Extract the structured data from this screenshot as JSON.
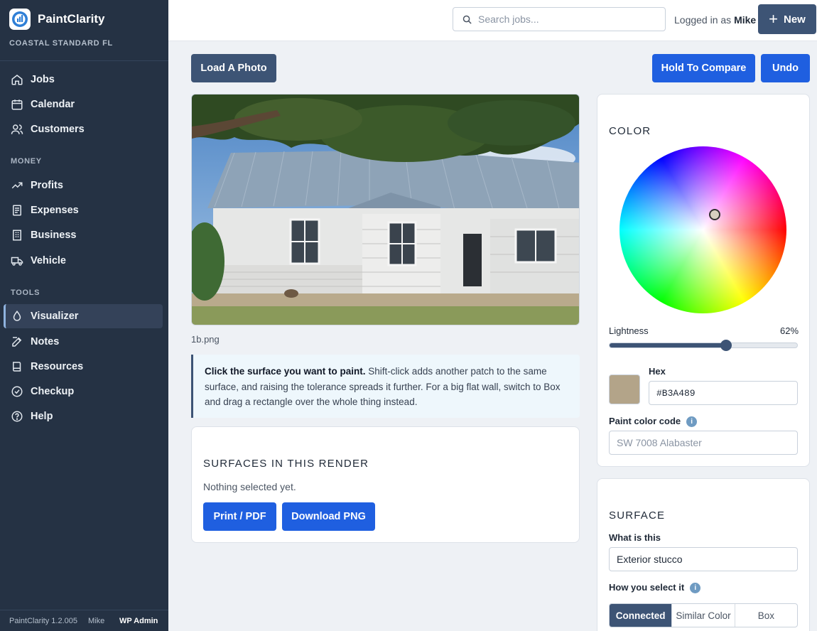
{
  "app": {
    "name": "PaintClarity",
    "org": "COASTAL STANDARD FL",
    "version": "PaintClarity 1.2.005",
    "footer_user": "Mike",
    "footer_admin": "WP Admin"
  },
  "sidebar": {
    "main_items": [
      {
        "label": "Jobs",
        "icon": "home-icon"
      },
      {
        "label": "Calendar",
        "icon": "calendar-icon"
      },
      {
        "label": "Customers",
        "icon": "users-icon"
      }
    ],
    "money_title": "MONEY",
    "money_items": [
      {
        "label": "Profits",
        "icon": "trending-up-icon"
      },
      {
        "label": "Expenses",
        "icon": "receipt-icon"
      },
      {
        "label": "Business",
        "icon": "building-icon"
      },
      {
        "label": "Vehicle",
        "icon": "truck-icon"
      }
    ],
    "tools_title": "TOOLS",
    "tools_items": [
      {
        "label": "Visualizer",
        "icon": "droplet-icon",
        "active": true
      },
      {
        "label": "Notes",
        "icon": "edit-icon"
      },
      {
        "label": "Resources",
        "icon": "book-icon"
      },
      {
        "label": "Checkup",
        "icon": "check-circle-icon"
      },
      {
        "label": "Help",
        "icon": "help-circle-icon"
      }
    ]
  },
  "topbar": {
    "search_placeholder": "Search jobs...",
    "logged_prefix": "Logged in as",
    "logged_user": "Mike",
    "new_label": "New"
  },
  "toolbar": {
    "load_photo": "Load A Photo",
    "hold_compare": "Hold To Compare",
    "undo": "Undo"
  },
  "photo": {
    "filename": "1b.png"
  },
  "tip": {
    "bold": "Click the surface you want to paint.",
    "text": " Shift-click adds another patch to the same surface, and raising the tolerance spreads it further. For a big flat wall, switch to Box and drag a rectangle over the whole thing instead."
  },
  "surfaces_card": {
    "title": "SURFACES IN THIS RENDER",
    "empty": "Nothing selected yet.",
    "print": "Print / PDF",
    "download": "Download PNG"
  },
  "color_panel": {
    "title": "COLOR",
    "lightness_label": "Lightness",
    "lightness_value": "62%",
    "lightness": 0.62,
    "hex_label": "Hex",
    "hex_value": "#B3A489",
    "swatch_color": "#B3A489",
    "paint_code_label": "Paint color code",
    "paint_code_placeholder": "SW 7008 Alabaster"
  },
  "surface_panel": {
    "title": "SURFACE",
    "what_label": "What is this",
    "what_value": "Exterior stucco",
    "how_label": "How you select it",
    "modes": [
      "Connected",
      "Similar Color",
      "Box"
    ],
    "active_mode": 0
  },
  "colors": {
    "sidebar_bg": "#253244",
    "accent_dark": "#3d5475",
    "accent_blue": "#1f5fe0"
  }
}
